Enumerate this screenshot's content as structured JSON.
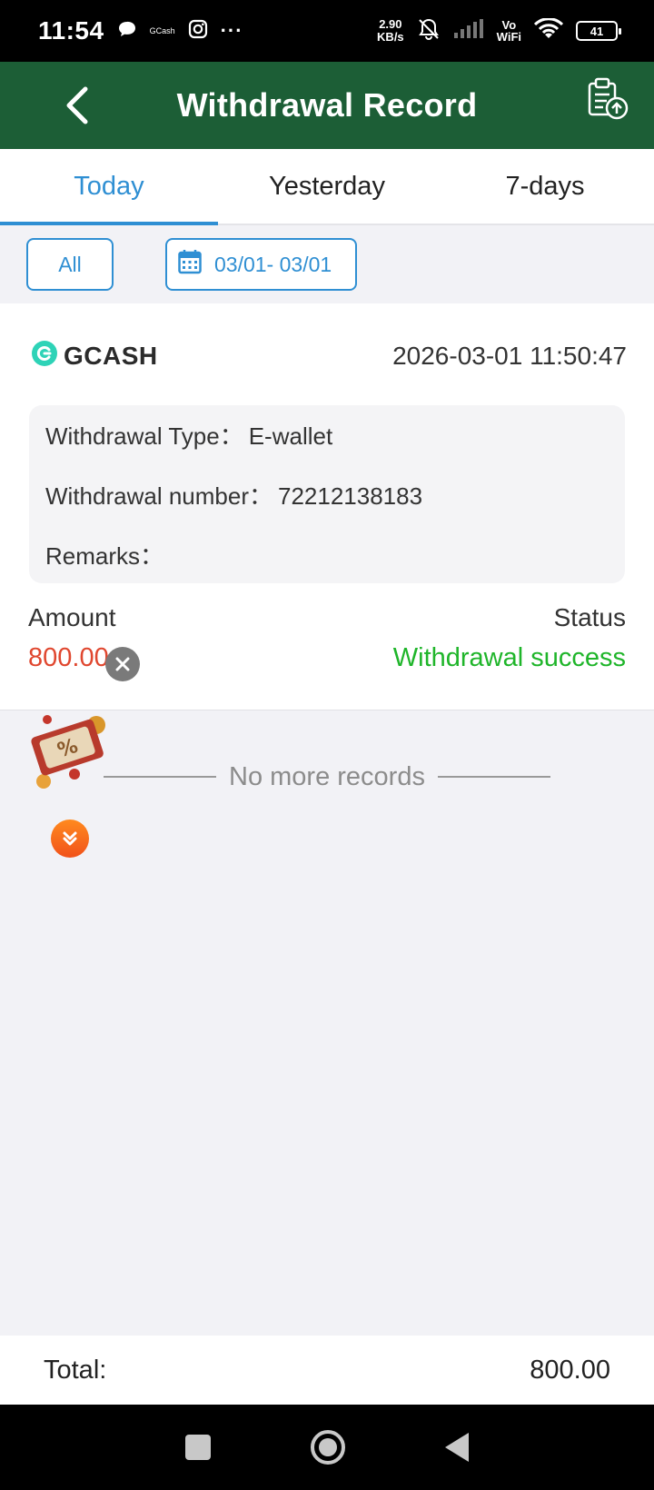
{
  "status_bar": {
    "time": "11:54",
    "gcash_app_label": "GCash",
    "more_icon": "···",
    "network_speed_value": "2.90",
    "network_speed_unit": "KB/s",
    "vo_label": "Vo",
    "wifi_label": "WiFi",
    "battery": "41"
  },
  "header": {
    "title": "Withdrawal Record",
    "back_icon": "chevron-left-icon",
    "action_icon": "clipboard-upload-icon"
  },
  "tabs": [
    {
      "label": "Today",
      "active": true
    },
    {
      "label": "Yesterday",
      "active": false
    },
    {
      "label": "7-days",
      "active": false
    }
  ],
  "filters": {
    "all_label": "All",
    "date_range": "03/01- 03/01"
  },
  "record": {
    "provider": "GCASH",
    "datetime": "2026-03-01 11:50:47",
    "type_label": "Withdrawal Type：",
    "type_value": "E-wallet",
    "number_label": "Withdrawal number：",
    "number_value": "72212138183",
    "remarks_label": "Remarks：",
    "remarks_value": "",
    "amount_label": "Amount",
    "amount_value": "800.00",
    "status_label": "Status",
    "status_value": "Withdrawal success"
  },
  "list_footer": {
    "no_more_text": "No more records"
  },
  "total": {
    "label": "Total:",
    "value": "800.00"
  },
  "colors": {
    "header_green": "#1c5e36",
    "accent_blue": "#2f8fd3",
    "amount_red": "#e0472f",
    "success_green": "#1fb52a"
  }
}
